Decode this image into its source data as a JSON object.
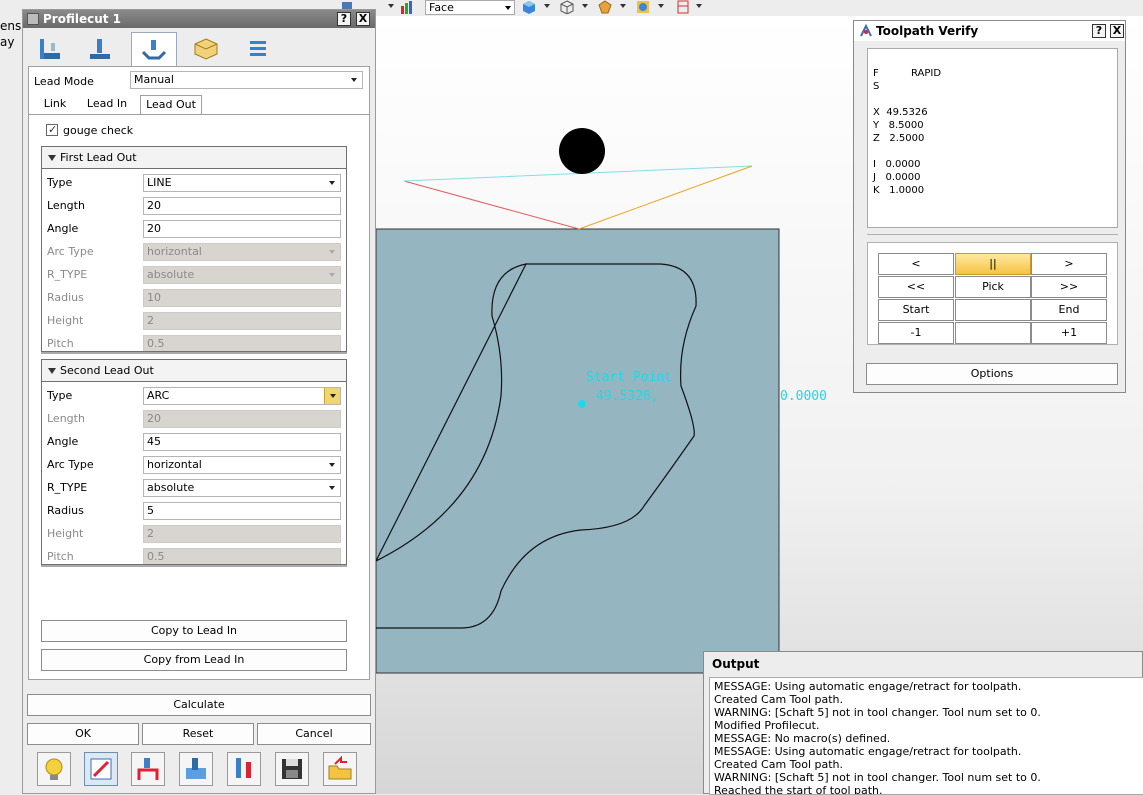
{
  "left_clip": [
    "ens",
    "ay"
  ],
  "toolbar": {
    "face_select": "Face"
  },
  "profilecut": {
    "title": "Profilecut 1",
    "help": "?",
    "close": "X",
    "tab_icons": [
      "setup-icon",
      "tool-icon",
      "leads-icon",
      "stock-icon",
      "parameters-icon"
    ],
    "lead_mode_label": "Lead Mode",
    "lead_mode_value": "Manual",
    "subtabs": [
      "Link",
      "Lead In",
      "Lead Out"
    ],
    "gouge_check_label": "gouge check",
    "first_lead_out": {
      "title": "First Lead Out",
      "fields": [
        {
          "label": "Type",
          "value": "LINE",
          "kind": "select",
          "enabled": true
        },
        {
          "label": "Length",
          "value": "20",
          "kind": "text",
          "enabled": true
        },
        {
          "label": "Angle",
          "value": "20",
          "kind": "text",
          "enabled": true
        },
        {
          "label": "Arc Type",
          "value": "horizontal",
          "kind": "select",
          "enabled": false
        },
        {
          "label": "R_TYPE",
          "value": "absolute",
          "kind": "select",
          "enabled": false
        },
        {
          "label": "Radius",
          "value": "10",
          "kind": "text",
          "enabled": false
        },
        {
          "label": "Height",
          "value": "2",
          "kind": "text",
          "enabled": false
        },
        {
          "label": "Pitch",
          "value": "0.5",
          "kind": "text",
          "enabled": false
        }
      ]
    },
    "second_lead_out": {
      "title": "Second Lead Out",
      "fields": [
        {
          "label": "Type",
          "value": "ARC",
          "kind": "select-active",
          "enabled": true
        },
        {
          "label": "Length",
          "value": "20",
          "kind": "text",
          "enabled": false
        },
        {
          "label": "Angle",
          "value": "45",
          "kind": "text",
          "enabled": true
        },
        {
          "label": "Arc Type",
          "value": "horizontal",
          "kind": "select",
          "enabled": true
        },
        {
          "label": "R_TYPE",
          "value": "absolute",
          "kind": "select",
          "enabled": true
        },
        {
          "label": "Radius",
          "value": "5",
          "kind": "text",
          "enabled": true
        },
        {
          "label": "Height",
          "value": "2",
          "kind": "text",
          "enabled": false
        },
        {
          "label": "Pitch",
          "value": "0.5",
          "kind": "text",
          "enabled": false
        }
      ]
    },
    "copy_to_lead_in": "Copy to Lead In",
    "copy_from_lead_in": "Copy from Lead In",
    "calculate": "Calculate",
    "ok": "OK",
    "reset": "Reset",
    "cancel": "Cancel",
    "bottom_icons": [
      "tip-icon",
      "edit-icon",
      "toolpath-icon",
      "simulate-icon",
      "tools-icon",
      "save-icon",
      "export-icon"
    ]
  },
  "viewport": {
    "start_point_label": "Start Point",
    "start_coords": "49.5326, ",
    "coord_suffix": "0.0000"
  },
  "verify": {
    "title": "Toolpath Verify",
    "help": "?",
    "close": "X",
    "readout": {
      "f_label": "F",
      "f_value": "RAPID",
      "s_label": "S",
      "x": "X  49.5326",
      "y": "Y   8.5000",
      "z": "Z   2.5000",
      "i": "I   0.0000",
      "j": "J   0.0000",
      "k": "K   1.0000"
    },
    "buttons": [
      "<",
      "||",
      ">",
      "<<",
      "Pick",
      ">>",
      "Start",
      "",
      "End",
      "-1",
      "",
      "+1"
    ],
    "options": "Options"
  },
  "output": {
    "title": "Output",
    "lines": [
      "MESSAGE: Using automatic engage/retract for toolpath.",
      "Created Cam Tool path.",
      "WARNING: [Schaft 5] not in tool changer. Tool num set to 0.",
      "Modified Profilecut.",
      "MESSAGE: No macro(s) defined.",
      "MESSAGE: Using automatic engage/retract for toolpath.",
      "Created Cam Tool path.",
      "WARNING: [Schaft 5] not in tool changer. Tool num set to 0.",
      "Reached the start of tool path."
    ]
  }
}
